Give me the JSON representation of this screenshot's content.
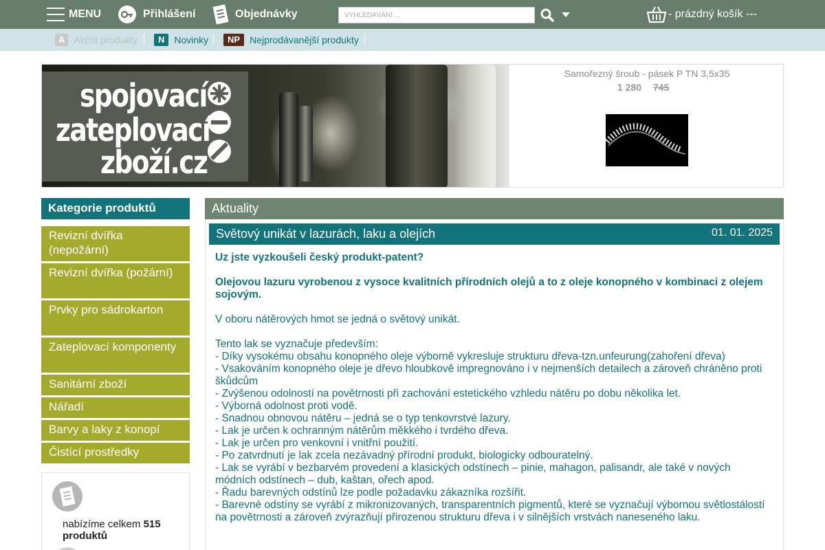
{
  "topbar": {
    "menu_label": "MENU",
    "login_label": "Přihlášení",
    "orders_label": "Objednávky",
    "search_placeholder": "VYHLEDÁVÁNÍ ...",
    "cart_label": "- prázdný košík ---"
  },
  "subnav": {
    "items": [
      {
        "badge": "A",
        "label": "Akční produkty",
        "badge_color": "#c9c9c9",
        "text_color": "#b9c3c5"
      },
      {
        "badge": "N",
        "label": "Novinky",
        "badge_color": "#12747a",
        "text_color": "#12747a"
      },
      {
        "badge": "NP",
        "label": "Nejprodávanější produkty",
        "badge_color": "#5a2a18",
        "text_color": "#12747a"
      }
    ]
  },
  "banner": {
    "logo_lines": [
      "spojovací",
      "zateplovací",
      "zboží.cz"
    ],
    "product_name": "Samořezný šroub - pásek P TN 3,5x35",
    "price": "1 280",
    "old_price": "745"
  },
  "sidebar": {
    "header": "Kategorie produktů",
    "items": [
      {
        "label": "Revizní dvířka (nepožární)"
      },
      {
        "label": "Revizní dvířka (požární)"
      },
      {
        "label": "Prvky pro sádrokarton"
      },
      {
        "label": "Zateplovací komponenty"
      },
      {
        "label": "Sanitární zboží"
      },
      {
        "label": "Nářadí"
      },
      {
        "label": "Barvy a laky z konopí"
      },
      {
        "label": "Čistící prostředky"
      }
    ],
    "stats_prefix": "nabízíme celkem",
    "stats_count": "515",
    "stats_suffix": "produktů"
  },
  "news": {
    "header": "Aktuality",
    "article": {
      "title": "Světový unikát v lazurách, laku a olejích",
      "date": "01. 01. 2025",
      "intro_bold_1": "Uz jste vyzkoušeli český produkt-patent?",
      "intro_bold_2": "Olejovou lazuru vyrobenou z vysoce kvalitních přírodních olejů a to z oleje konopného v kombinaci z olejem sojovým.",
      "para_1": "V oboru nátěrových hmot se jedná o světový unikát.",
      "list_intro": "Tento lak se vyznačuje především:",
      "list": [
        "- Díky vysokému obsahu konopného oleje výborně vykresluje strukturu dřeva-tzn.unfeurung(zahoření dřeva)",
        "- Vsakováním konopného oleje je dřevo hloubkově impregnováno i v nejmenších detailech a zároveň chráněno proti škůdcům",
        "- Zvýšenou odolností na povětrnosti při zachování estetického vzhledu nátěru po dobu několika let.",
        "- Výborná odolnost proti vodě.",
        "- Snadnou obnovou nátěru – jedná se o typ tenkovrstvé lazury.",
        "- Lak je určen k ochranným nátěrům měkkého i tvrdého dřeva.",
        "- Lak je určen pro venkovní i vnitřní použití.",
        "- Po zatvrdnutí je lak zcela nezávadný přírodní produkt, biologicky odbouratelný.",
        "- Lak se vyrábí v bezbarvém provedení a klasických odstínech – pinie, mahagon, palisandr, ale také v nových módních odstínech – dub, kaštan, ořech apod.",
        "- Řadu barevných odstínů lze podle požadavku zákazníka rozšířit.",
        "- Barevné odstíny se vyrábí z mikronizovaných, transparentních pigmentů, které se vyznačují výbornou světlostálostí na povětrnosti a zároveň zvýrazňují přirozenou strukturu dřeva i v silnějších vrstvách naneseného laku."
      ]
    }
  },
  "colors": {
    "topbar": "#657d6a",
    "subbar": "#cfe3e7",
    "teal": "#12747a",
    "category": "#a4aa2c",
    "news_header": "#6d8571"
  },
  "icons": [
    "hamburger-icon",
    "key-icon",
    "document-icon",
    "search-icon",
    "chevron-down-icon",
    "basket-icon",
    "list-document-icon"
  ]
}
